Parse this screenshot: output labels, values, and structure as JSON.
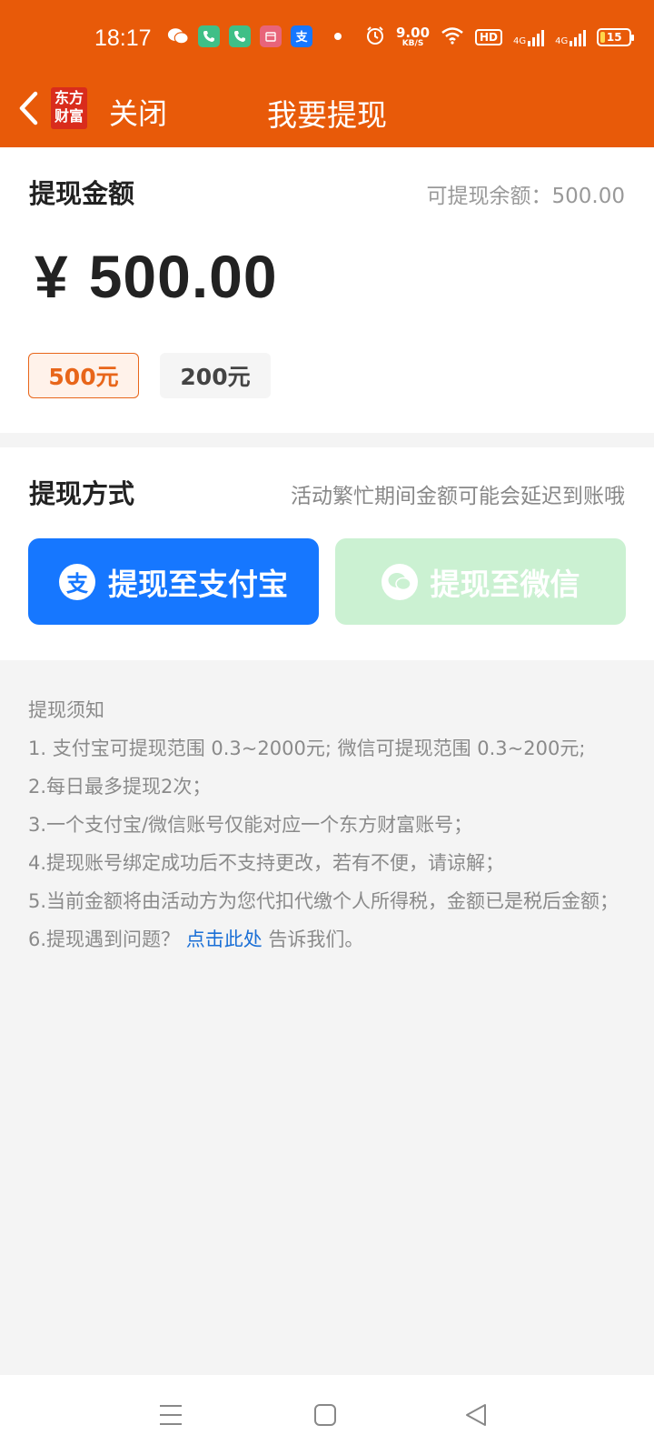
{
  "status_bar": {
    "time": "18:17",
    "net_speed_value": "9.00",
    "net_speed_unit": "KB/S",
    "hd_label": "HD",
    "signal_label_1": "4G",
    "signal_label_2": "4G",
    "battery_level": "15",
    "icons": [
      "wechat-icon",
      "phone-icon",
      "phone-icon",
      "calendar-icon",
      "alipay-icon",
      "dot-icon",
      "alarm-icon",
      "wifi-icon"
    ]
  },
  "header": {
    "logo_line1": "东方",
    "logo_line2": "财富",
    "close_label": "关闭",
    "title": "我要提现"
  },
  "amount_section": {
    "title": "提现金额",
    "available_label": "可提现余额：500.00",
    "currency": "¥",
    "amount": "500.00",
    "options": [
      {
        "label": "500元",
        "selected": true
      },
      {
        "label": "200元",
        "selected": false
      }
    ]
  },
  "method_section": {
    "title": "提现方式",
    "tip": "活动繁忙期间金额可能会延迟到账哦",
    "alipay_label": "提现至支付宝",
    "alipay_icon_char": "支",
    "wechat_label": "提现至微信"
  },
  "notes": {
    "title": "提现须知",
    "items": [
      "1. 支付宝可提现范围 0.3~2000元; 微信可提现范围 0.3~200元;",
      "2.每日最多提现2次；",
      "3.一个支付宝/微信账号仅能对应一个东方财富账号；",
      "4.提现账号绑定成功后不支持更改，若有不便，请谅解；",
      "5.当前金额将由活动方为您代扣代缴个人所得税，金额已是税后金额；"
    ],
    "item6_prefix": "6.提现遇到问题？",
    "item6_link": "点击此处",
    "item6_suffix": " 告诉我们。"
  },
  "colors": {
    "brand_orange": "#e85a09",
    "alipay_blue": "#1677ff",
    "wechat_disabled_green": "#cbf1d2",
    "selected_chip": "#e8661a",
    "link_blue": "#1a6fd6"
  }
}
